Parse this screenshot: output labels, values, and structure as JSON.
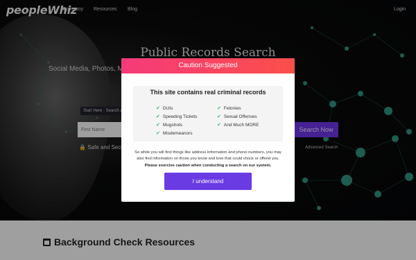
{
  "nav": {
    "logo": "peopleWhiz",
    "links": [
      "Company",
      "Resources",
      "Blog"
    ],
    "login": "Login"
  },
  "hero": {
    "title": "Public Records Search",
    "subtitle": "Social Media, Photos, M                                                                     o and more. You may be",
    "start_here": "Start Here · Search a",
    "first_name_placeholder": "First Name",
    "search_button": "Search Now",
    "safe_text": "Safe and Secure",
    "advanced_search": "Advanced Search"
  },
  "lower": {
    "title": "Background Check Resources"
  },
  "modal": {
    "header": "Caution Suggested",
    "notice_title": "This site contains real criminal records",
    "col1": [
      "DUIs",
      "Speeding Tickets",
      "Mugshots",
      "Misdemeanors"
    ],
    "col2": [
      "Felonies",
      "Sexual Offenses",
      "And Much MORE"
    ],
    "body_plain": "So while you will find things like address information and phone numbers, you may also find information on those you know and love that could shock or offend you.",
    "body_bold": "Please exercise caution when conducting a search on our system.",
    "button": "I understand"
  },
  "colors": {
    "accent": "#6a3be3",
    "header_gradient_start": "#f63a7a",
    "header_gradient_end": "#fb4f4a",
    "check": "#3bb56a"
  }
}
